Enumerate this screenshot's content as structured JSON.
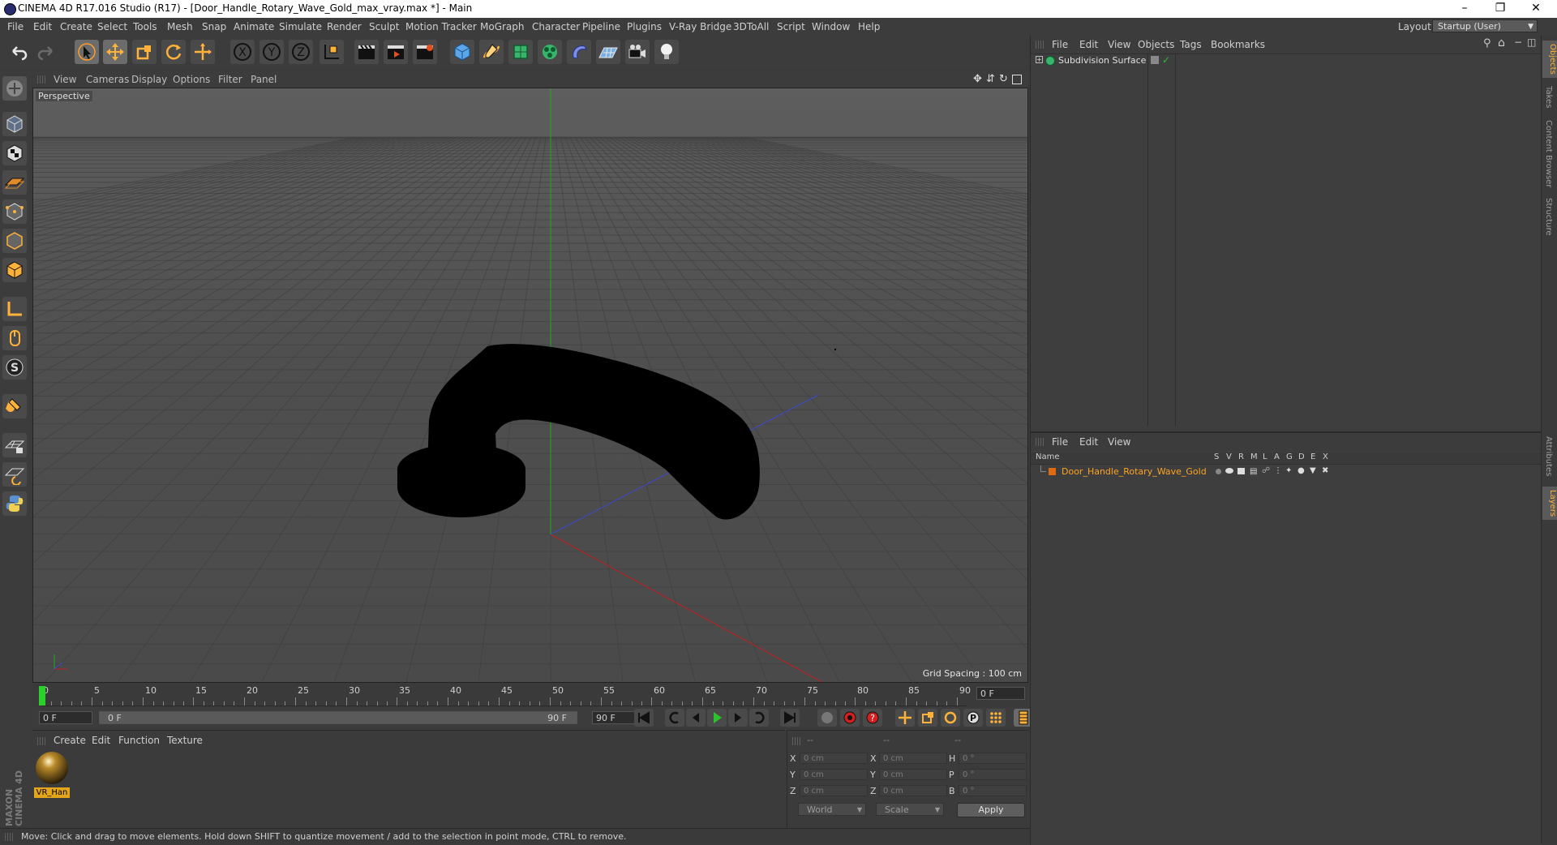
{
  "window": {
    "title": "CINEMA 4D R17.016 Studio (R17) - [Door_Handle_Rotary_Wave_Gold_max_vray.max *] - Main",
    "minimize": "–",
    "maximize": "❐",
    "close": "✕"
  },
  "menubar": {
    "items": [
      "File",
      "Edit",
      "Create",
      "Select",
      "Tools",
      "Mesh",
      "Snap",
      "Animate",
      "Simulate",
      "Render",
      "Sculpt",
      "Motion Tracker",
      "MoGraph",
      "Character",
      "Pipeline",
      "Plugins",
      "V-Ray Bridge",
      "3DToAll",
      "Script",
      "Window",
      "Help"
    ],
    "layout_label": "Layout:",
    "layout_value": "Startup (User)"
  },
  "viewport": {
    "menu": [
      "View",
      "Cameras",
      "Display",
      "Options",
      "Filter",
      "Panel"
    ],
    "camera_label": "Perspective",
    "grid_spacing": "Grid Spacing : 100 cm"
  },
  "timeline": {
    "ticks": [
      "0",
      "5",
      "10",
      "15",
      "20",
      "25",
      "30",
      "35",
      "40",
      "45",
      "50",
      "55",
      "60",
      "65",
      "70",
      "75",
      "80",
      "85",
      "90"
    ],
    "current_frame": "0 F"
  },
  "transport": {
    "start_field": "0 F",
    "range_start": "0 F",
    "range_end": "90 F",
    "end_field": "90 F"
  },
  "material_manager": {
    "menu": [
      "Create",
      "Edit",
      "Function",
      "Texture"
    ],
    "material_name": "VR_Han",
    "material_color": "#e3a51a"
  },
  "coordinates": {
    "header": [
      "--",
      "--",
      "--"
    ],
    "rows": [
      {
        "a": "X",
        "av": "0 cm",
        "b": "X",
        "bv": "0 cm",
        "c": "H",
        "cv": "0 °"
      },
      {
        "a": "Y",
        "av": "0 cm",
        "b": "Y",
        "bv": "0 cm",
        "c": "P",
        "cv": "0 °"
      },
      {
        "a": "Z",
        "av": "0 cm",
        "b": "Z",
        "bv": "0 cm",
        "c": "B",
        "cv": "0 °"
      }
    ],
    "mode1": "World",
    "mode2": "Scale",
    "apply": "Apply"
  },
  "status": {
    "text": "Move: Click and drag to move elements. Hold down SHIFT to quantize movement / add to the selection in point mode, CTRL to remove."
  },
  "objects_panel": {
    "menu": [
      "File",
      "Edit",
      "View",
      "Objects",
      "Tags",
      "Bookmarks"
    ],
    "object_name": "Subdivision Surface"
  },
  "layers_panel": {
    "menu": [
      "File",
      "Edit",
      "View"
    ],
    "headers": [
      "Name",
      "S",
      "V",
      "R",
      "M",
      "L",
      "A",
      "G",
      "D",
      "E",
      "X"
    ],
    "layer_name": "Door_Handle_Rotary_Wave_Gold",
    "layer_color": "#e06a10"
  },
  "side_tabs": [
    "Objects",
    "Takes",
    "Content Browser",
    "Structure",
    "Attributes",
    "Layers"
  ],
  "brand": "MAXON CINEMA 4D",
  "colors": {
    "accent": "#ffb23a",
    "x_axis": "#c02020",
    "y_axis": "#1fa81f",
    "z_axis": "#3a4ad0"
  }
}
